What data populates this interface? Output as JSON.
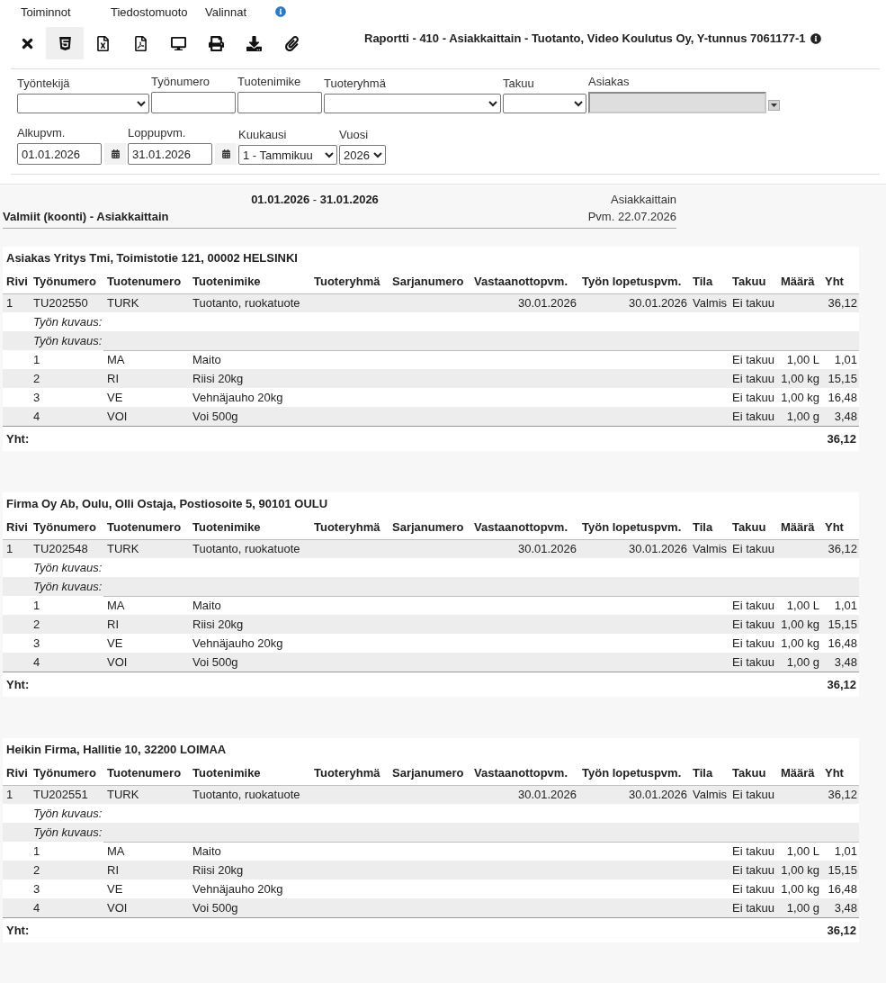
{
  "menu": [
    {
      "label": "Toiminnot",
      "info": false
    },
    {
      "label": "Tiedostomuoto",
      "info": false
    },
    {
      "label": "Valinnat",
      "info": true
    }
  ],
  "toolbar": [
    {
      "kind": "close",
      "selected": false
    },
    {
      "kind": "html",
      "selected": true
    },
    {
      "kind": "excel",
      "selected": false
    },
    {
      "kind": "pdf",
      "selected": false
    },
    {
      "kind": "screen",
      "selected": false
    },
    {
      "kind": "print",
      "selected": false
    },
    {
      "kind": "download",
      "selected": false
    },
    {
      "kind": "attach",
      "selected": false
    }
  ],
  "report_title": "Raportti - 410 - Asiakkaittain - Tuotanto, Video Koulutus Oy, Y-tunnus 7061177-1",
  "filters": [
    [
      {
        "label": "Työntekijä",
        "kind": "select"
      },
      {
        "label": "Työnumero",
        "kind": "text"
      },
      {
        "label": "Tuotenimike",
        "kind": "text"
      },
      {
        "label": "Tuoteryhmä",
        "kind": "select"
      },
      {
        "label": "Takuu",
        "kind": "select"
      },
      {
        "label": "Asiakas",
        "kind": "lookup"
      }
    ],
    [
      {
        "label": "Alkupvm.",
        "kind": "date",
        "value": "01.01.2026"
      },
      {
        "label": "Loppupvm.",
        "kind": "date",
        "value": "31.01.2026"
      },
      {
        "label": "Kuukausi",
        "kind": "select",
        "value": "1 - Tammikuu"
      },
      {
        "label": "Vuosi",
        "kind": "select",
        "value": "2026"
      }
    ]
  ],
  "report_header": {
    "period": "**01.01.2026** - **31.01.2026**",
    "view": "Asiakkaittain",
    "subtitle": "Valmiit (koonti) - Asiakkaittain",
    "date": "Pvm. 22.07.2026"
  },
  "sections": [
    {
      "title": "Asiakas Yritys Tmi, Toimistotie 121, 00002 HELSINKI",
      "columns": [
        "Rivi",
        "Työnumero",
        "Tuotenumero",
        "Tuotenimike",
        "Tuoteryhmä",
        "Sarjanumero",
        "Vastaanottopvm.",
        "Työn lopetuspvm.",
        "Tila",
        "Takuu",
        "Määrä",
        "Yht"
      ],
      "rows": [
        {
          "kind": "work",
          "row_number": "1",
          "work_number": "TU202550",
          "product_number": "TURK",
          "product_name": "Tuotanto, ruokatuote",
          "received": "30.01.2026",
          "finished": "30.01.2026",
          "status": "Valmis",
          "warranty": "Ei takuu",
          "total": "36,12"
        },
        {
          "kind": "description",
          "label": "Työn kuvaus:"
        },
        {
          "kind": "description",
          "label": "Työn kuvaus:"
        },
        {
          "kind": "item",
          "number": "1",
          "code": "MA",
          "name": "Maito",
          "warranty": "Ei takuu",
          "quantity": "1,00 L",
          "total": "1,01"
        },
        {
          "kind": "item",
          "number": "2",
          "code": "RI",
          "name": "Riisi 20kg",
          "warranty": "Ei takuu",
          "quantity": "1,00 kg",
          "total": "15,15"
        },
        {
          "kind": "item",
          "number": "3",
          "code": "VE",
          "name": "Vehnäjauho 20kg",
          "warranty": "Ei takuu",
          "quantity": "1,00 kg",
          "total": "16,48"
        },
        {
          "kind": "item",
          "number": "4",
          "code": "VOI",
          "name": "Voi 500g",
          "warranty": "Ei takuu",
          "quantity": "1,00 g",
          "total": "3,48"
        }
      ],
      "total_label": "Yht:",
      "total": "36,12"
    },
    {
      "title": "Firma Oy Ab, Oulu, Olli Ostaja, Postiosoite 5, 90101 OULU",
      "columns": [
        "Rivi",
        "Työnumero",
        "Tuotenumero",
        "Tuotenimike",
        "Tuoteryhmä",
        "Sarjanumero",
        "Vastaanottopvm.",
        "Työn lopetuspvm.",
        "Tila",
        "Takuu",
        "Määrä",
        "Yht"
      ],
      "rows": [
        {
          "kind": "work",
          "row_number": "1",
          "work_number": "TU202548",
          "product_number": "TURK",
          "product_name": "Tuotanto, ruokatuote",
          "received": "30.01.2026",
          "finished": "30.01.2026",
          "status": "Valmis",
          "warranty": "Ei takuu",
          "total": "36,12"
        },
        {
          "kind": "description",
          "label": "Työn kuvaus:"
        },
        {
          "kind": "description",
          "label": "Työn kuvaus:"
        },
        {
          "kind": "item",
          "number": "1",
          "code": "MA",
          "name": "Maito",
          "warranty": "Ei takuu",
          "quantity": "1,00 L",
          "total": "1,01"
        },
        {
          "kind": "item",
          "number": "2",
          "code": "RI",
          "name": "Riisi 20kg",
          "warranty": "Ei takuu",
          "quantity": "1,00 kg",
          "total": "15,15"
        },
        {
          "kind": "item",
          "number": "3",
          "code": "VE",
          "name": "Vehnäjauho 20kg",
          "warranty": "Ei takuu",
          "quantity": "1,00 kg",
          "total": "16,48"
        },
        {
          "kind": "item",
          "number": "4",
          "code": "VOI",
          "name": "Voi 500g",
          "warranty": "Ei takuu",
          "quantity": "1,00 g",
          "total": "3,48"
        }
      ],
      "total_label": "Yht:",
      "total": "36,12"
    },
    {
      "title": "Heikin Firma, Hallitie 10, 32200 LOIMAA",
      "columns": [
        "Rivi",
        "Työnumero",
        "Tuotenumero",
        "Tuotenimike",
        "Tuoteryhmä",
        "Sarjanumero",
        "Vastaanottopvm.",
        "Työn lopetuspvm.",
        "Tila",
        "Takuu",
        "Määrä",
        "Yht"
      ],
      "rows": [
        {
          "kind": "work",
          "row_number": "1",
          "work_number": "TU202551",
          "product_number": "TURK",
          "product_name": "Tuotanto, ruokatuote",
          "received": "30.01.2026",
          "finished": "30.01.2026",
          "status": "Valmis",
          "warranty": "Ei takuu",
          "total": "36,12"
        },
        {
          "kind": "description",
          "label": "Työn kuvaus:"
        },
        {
          "kind": "description",
          "label": "Työn kuvaus:"
        },
        {
          "kind": "item",
          "number": "1",
          "code": "MA",
          "name": "Maito",
          "warranty": "Ei takuu",
          "quantity": "1,00 L",
          "total": "1,01"
        },
        {
          "kind": "item",
          "number": "2",
          "code": "RI",
          "name": "Riisi 20kg",
          "warranty": "Ei takuu",
          "quantity": "1,00 kg",
          "total": "15,15"
        },
        {
          "kind": "item",
          "number": "3",
          "code": "VE",
          "name": "Vehnäjauho 20kg",
          "warranty": "Ei takuu",
          "quantity": "1,00 kg",
          "total": "16,48"
        },
        {
          "kind": "item",
          "number": "4",
          "code": "VOI",
          "name": "Voi 500g",
          "warranty": "Ei takuu",
          "quantity": "1,00 g",
          "total": "3,48"
        }
      ],
      "total_label": "Yht:",
      "total": "36,12"
    }
  ]
}
